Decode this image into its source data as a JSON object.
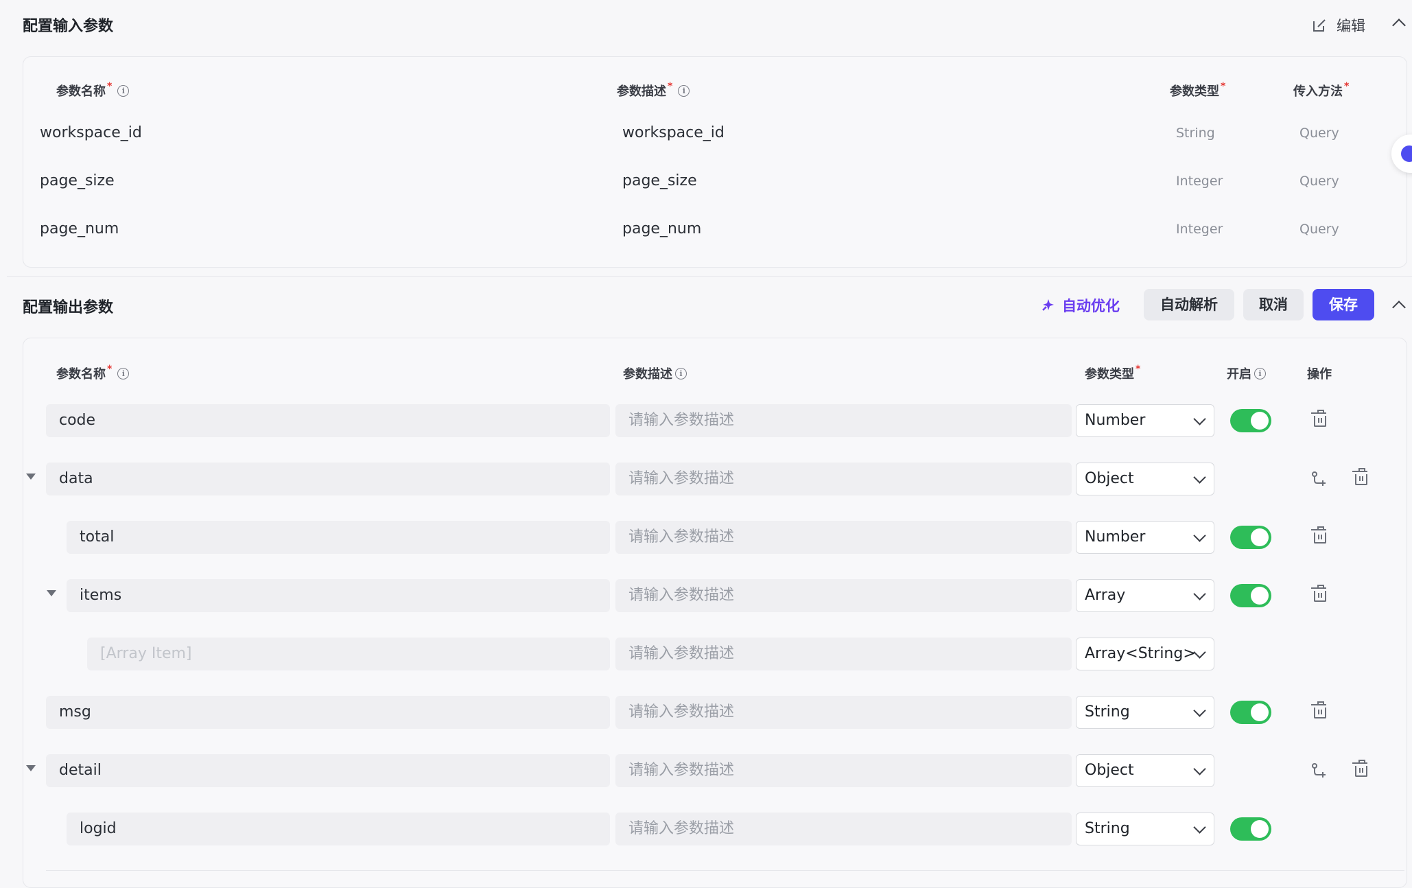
{
  "input_section": {
    "title": "配置输入参数",
    "edit_label": "编辑",
    "headers": {
      "name": "参数名称",
      "desc": "参数描述",
      "type": "参数类型",
      "method": "传入方法"
    },
    "rows": [
      {
        "name": "workspace_id",
        "desc": "workspace_id",
        "type": "String",
        "method": "Query"
      },
      {
        "name": "page_size",
        "desc": "page_size",
        "type": "Integer",
        "method": "Query"
      },
      {
        "name": "page_num",
        "desc": "page_num",
        "type": "Integer",
        "method": "Query"
      }
    ]
  },
  "output_section": {
    "title": "配置输出参数",
    "auto_optimize_label": "自动优化",
    "auto_parse_label": "自动解析",
    "cancel_label": "取消",
    "save_label": "保存",
    "headers": {
      "name": "参数名称",
      "desc": "参数描述",
      "type": "参数类型",
      "enable": "开启",
      "action": "操作"
    },
    "desc_placeholder": "请输入参数描述",
    "rows": [
      {
        "name": "code",
        "type": "Number",
        "enabled": true
      },
      {
        "name": "data",
        "type": "Object",
        "expanded": true
      },
      {
        "name": "total",
        "type": "Number",
        "enabled": true
      },
      {
        "name": "items",
        "type": "Array",
        "enabled": true,
        "expanded": true
      },
      {
        "name": "[Array Item]",
        "type": "Array<String>"
      },
      {
        "name": "msg",
        "type": "String",
        "enabled": true
      },
      {
        "name": "detail",
        "type": "Object",
        "expanded": true
      },
      {
        "name": "logid",
        "type": "String",
        "enabled": true
      }
    ]
  },
  "colors": {
    "accent": "#4e4cf0",
    "toggle_on": "#2ebd59",
    "required": "#e53935",
    "optimize": "#6a3df0"
  }
}
